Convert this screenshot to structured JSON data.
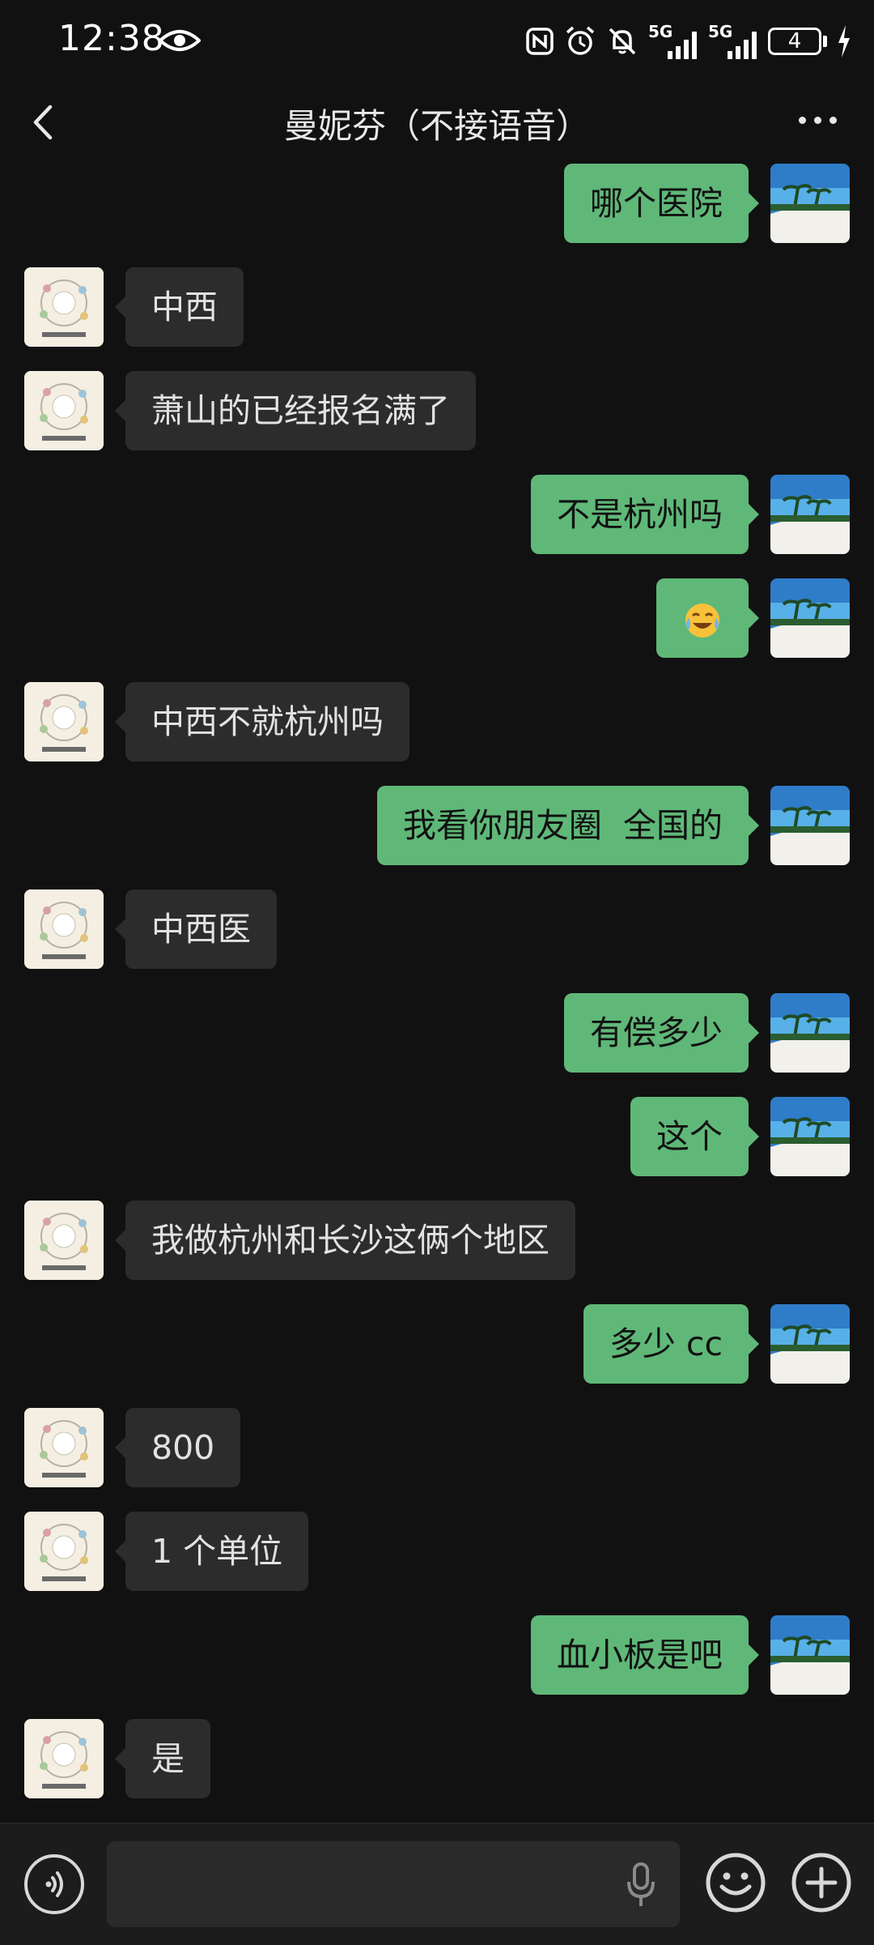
{
  "status": {
    "time": "12:38",
    "battery": "4",
    "network_1": "5G",
    "network_2": "5G"
  },
  "nav": {
    "title": "曼妮芬（不接语音）"
  },
  "messages": [
    {
      "side": "sent",
      "text": "哪个医院"
    },
    {
      "side": "recv",
      "text": "中西"
    },
    {
      "side": "recv",
      "text": "萧山的已经报名满了"
    },
    {
      "side": "sent",
      "text": "不是杭州吗"
    },
    {
      "side": "sent",
      "text": "",
      "emoji": "laughing-crying-emoji"
    },
    {
      "side": "recv",
      "text": "中西不就杭州吗"
    },
    {
      "side": "sent",
      "text": "我看你朋友圈  全国的"
    },
    {
      "side": "recv",
      "text": "中西医"
    },
    {
      "side": "sent",
      "text": "有偿多少"
    },
    {
      "side": "sent",
      "text": "这个"
    },
    {
      "side": "recv",
      "text": "我做杭州和长沙这俩个地区"
    },
    {
      "side": "sent",
      "text": "多少 cc"
    },
    {
      "side": "recv",
      "text": "800"
    },
    {
      "side": "recv",
      "text": "1 个单位"
    },
    {
      "side": "sent",
      "text": "血小板是吧"
    },
    {
      "side": "recv",
      "text": "是"
    }
  ],
  "colors": {
    "background": "#111111",
    "sent_bubble": "#5fb878",
    "recv_bubble": "#2c2c2c"
  },
  "icons": {
    "back": "back-arrow-icon",
    "more": "more-dots-icon",
    "voice": "voice-toggle-icon",
    "mic": "microphone-icon",
    "emoji": "emoji-icon",
    "plus": "plus-icon"
  }
}
